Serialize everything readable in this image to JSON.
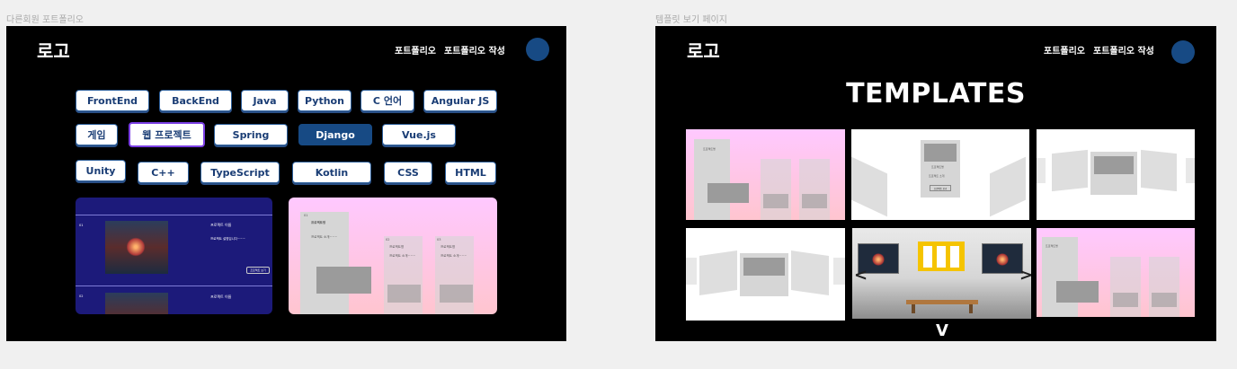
{
  "frames": {
    "left_label": "다른회원 포트폴리오",
    "right_label": "템플릿 보기 페이지"
  },
  "header": {
    "logo": "로고",
    "nav_portfolio": "포트폴리오",
    "nav_write": "포트폴리오 작성"
  },
  "tags": [
    {
      "label": "FrontEnd",
      "state": "normal"
    },
    {
      "label": "BackEnd",
      "state": "normal"
    },
    {
      "label": "Java",
      "state": "normal"
    },
    {
      "label": "Python",
      "state": "normal"
    },
    {
      "label": "C 언어",
      "state": "normal"
    },
    {
      "label": "Angular JS",
      "state": "normal"
    },
    {
      "label": "게임",
      "state": "normal"
    },
    {
      "label": "웹 프로젝트",
      "state": "selected"
    },
    {
      "label": "Spring",
      "state": "normal"
    },
    {
      "label": "Django",
      "state": "active"
    },
    {
      "label": "Vue.js",
      "state": "normal"
    },
    {
      "label": "Unity",
      "state": "normal"
    },
    {
      "label": "C++",
      "state": "normal"
    },
    {
      "label": "TypeScript",
      "state": "normal"
    },
    {
      "label": "Kotlin",
      "state": "normal"
    },
    {
      "label": "CSS",
      "state": "normal"
    },
    {
      "label": "HTML",
      "state": "normal"
    }
  ],
  "portfolio_card": {
    "row1_num": "01",
    "row1_title": "프로젝트 이름",
    "row1_desc": "프로젝트 설명입니다~~~",
    "row1_button": "프로젝트 보기",
    "row2_num": "02",
    "row2_title": "프로젝트 이름",
    "colors": {
      "bg": "#1c1a7a",
      "line": "#7d7bd6"
    }
  },
  "pink_card": {
    "num1": "01",
    "name1": "프로젝트명",
    "sub1": "프로젝트 소개~~~",
    "num2": "02",
    "name2": "프로젝트명",
    "sub2": "프로젝트 소개~~~",
    "num3": "03",
    "name3": "프로젝트명",
    "sub3": "프로젝트 소개~~~"
  },
  "templates": {
    "title": "TEMPLATES",
    "project_label": "프로젝트명",
    "project_sub": "프로젝트 소개",
    "project_btn": "프로젝트 보기",
    "left_arrow": "<",
    "right_arrow": ">",
    "down_arrow": "V"
  }
}
